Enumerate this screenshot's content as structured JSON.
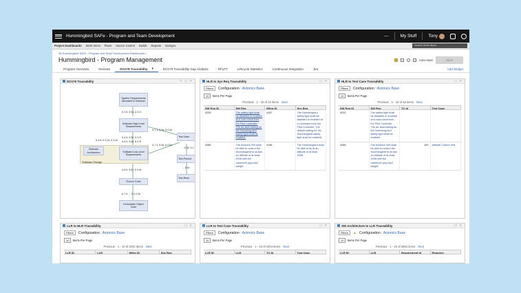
{
  "topbar": {
    "title": "Hummingbird SAFe - Program and Team Development",
    "my_stuff": "My Stuff",
    "user": "Tony",
    "more": "---"
  },
  "nav": {
    "items": [
      "Project Dashboards",
      "Work Items",
      "Plans",
      "Source Control",
      "Builds",
      "Reports",
      "Designs"
    ],
    "search_placeholder": "Search Work Items"
  },
  "breadcrumb": "All Hummingbird SAFe - Program and Team Development Dashboards /",
  "page_title": "Hummingbird - Program Management",
  "autosave": "Auto-save",
  "save": "Save",
  "tabs": [
    "Program Overview",
    "Reviews",
    "DO178 Traceability",
    "DO178 Traceability Gap Analysis",
    "RFLPT",
    "Lifecycle Statistics",
    "Continuous Integration",
    "Jira"
  ],
  "add_widget": "Add Widget",
  "common": {
    "filters": "Filters",
    "configuration": "Configuration",
    "items_per_page": "Items Per Page",
    "ipp_value": "10",
    "previous": "Previous",
    "next": "Next"
  },
  "do178": {
    "title": "DO178 Traceability",
    "boxes": {
      "sysreq": "System Requirements Allocated to Software",
      "hlr": "Software High Level Requirements",
      "arch": "Software Architecture",
      "llr": "Software Low Level Requirements",
      "src": "Source Code",
      "obj": "Executable Object Code",
      "design": "Software Design",
      "tc": "Test Case",
      "tp": "Test Proced",
      "tr": "Test Resu"
    },
    "labels": {
      "l1": "A-3.6, 5.5a, 6.3.1f",
      "l2": "A-4.6, 5.5b, 6.3.2f",
      "l3": "A-4.6, 5.2.2a, 6.3.2a",
      "l4": "A-4.6, 5.5b, 6.3.3f",
      "l5": "A-7.3, 6.3a, 6.4.3a",
      "l6": "A-7.4, 6.5a, 6.4.5a",
      "l7": "A-5.5, 5.5c, 6.3.4e",
      "l8": "A-7.5, ... 6.4.4.3b",
      "l9": ".. 6.5b, 6.4",
      "l10": "... 6.5c"
    }
  },
  "w_hlr_sys": {
    "title": "HLR to Sys Req Traceability",
    "config": "Avionics Base",
    "range": "1 - 10 of 16 items",
    "columns": [
      "SW Req ID",
      "SW Req",
      "SReq ID",
      "Sys Req"
    ],
    "rows": [
      [
        "4233",
        "The safety light shall be disabled or enabled at a com-mand from the Pilot Controller. The de-fault setting for the Humming-bird safety light shall be enabled.",
        "4167",
        "The Hummingbird safety light shall be disabled or enabled at a command from the Pilot Controller. The default setting for the Hummingbird safety light shall be enabled."
      ],
      [
        "4285",
        "The Avionics SW shall be able to control the Hummingbird to at-tain an altitude of at least 400ft with the maximum pay-load weight.",
        "4196",
        "The Hummingbird shall be able to fly at an altitude of at least 400ft."
      ]
    ]
  },
  "w_hlr_test": {
    "title": "HLR to Test Case Traceability",
    "config": "Avionics Base",
    "range": "1 - 10 of 16 items",
    "columns": [
      "SW Req ID",
      "SW Req",
      "TC Id",
      "Test Case"
    ],
    "rows": [
      [
        "4233",
        "The safety light shall be disabled or enabled at a com-mand from the Pilot Controller. The de-fault setting for the Humming-bird safety light shall be enabled.",
        "",
        ""
      ],
      [
        "4285",
        "The Avionics SW shall be able to control the Hummingbird to at-tain an altitude of at least 400ft with the maximum pay-load weight.",
        "100",
        "Altitude Control Test"
      ]
    ]
  },
  "w_llr_hlr": {
    "title": "LLR to HLR Traceability",
    "config": "Avionics Base",
    "range": "1 - 10 of 2032 items",
    "columns": [
      "LLR ID",
      "LLR",
      "SReq ID",
      "Sys Req"
    ]
  },
  "w_llr_test": {
    "title": "LLR to Test Case Traceability",
    "config": "Avionics Base",
    "range": "1 - 10 of 1914 items",
    "columns": [
      "LLR ID",
      "LLR",
      "TC ID",
      "Test Case"
    ]
  },
  "w_arch": {
    "title": "SW Architecture to LLR Traceability",
    "config": "Avionics Base",
    "range": "1 - 10 of 2664 items",
    "columns": [
      "LLR ID",
      "LLR",
      "Requirement Id",
      "Requiren"
    ]
  }
}
